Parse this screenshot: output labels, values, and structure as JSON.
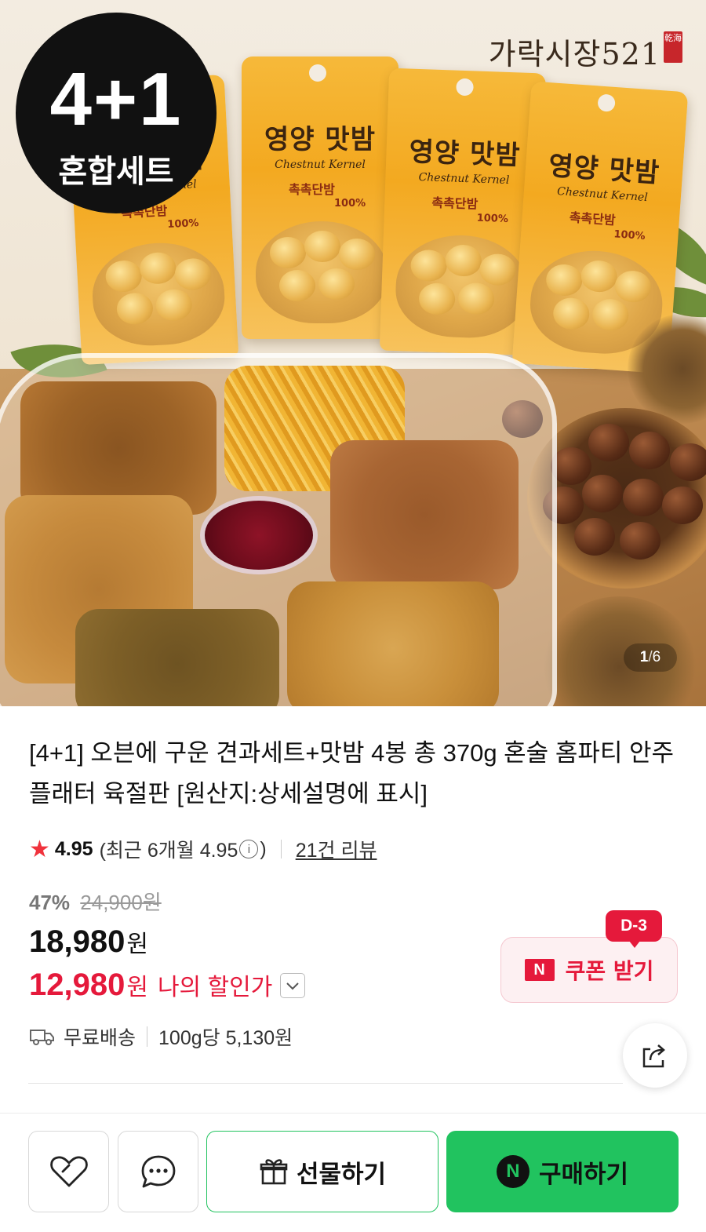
{
  "hero": {
    "brand": "가락시장521",
    "brand_seal": "乾海",
    "badge_top": "4+1",
    "badge_bottom": "혼합세트",
    "pouch_title": "영양 맛밤",
    "pouch_subtitle": "Chestnut Kernel",
    "pouch_tag": "촉촉단밤",
    "pouch_percent": "100%",
    "counter": {
      "current": "1",
      "separator": "/",
      "total": "6"
    }
  },
  "product": {
    "title": "[4+1] 오븐에 구운 견과세트+맛밤 4봉 총 370g 혼술 홈파티 안주 플래터 육절판 [원산지:상세설명에 표시]",
    "rating": {
      "star_icon": "star-icon",
      "score": "4.95",
      "recent_prefix": "(최근 6개월 4.95",
      "info_glyph": "i",
      "recent_suffix": ")",
      "reviews": "21건 리뷰"
    },
    "discount_pct": "47%",
    "original_price": "24,900원",
    "price": "18,980",
    "price_unit": "원",
    "my_price": "12,980",
    "my_price_unit": "원",
    "my_price_label": "나의 할인가",
    "coupon": {
      "dday": "D-3",
      "logo": "N",
      "label": "쿠폰 받기"
    },
    "shipping": "무료배송",
    "unit_price": "100g당 5,130원"
  },
  "bottom_bar": {
    "gift_label": "선물하기",
    "buy_logo": "N",
    "buy_label": "구매하기"
  },
  "colors": {
    "accent_red": "#e5193b",
    "naver_green": "#21c35f",
    "star": "#f0323c"
  }
}
